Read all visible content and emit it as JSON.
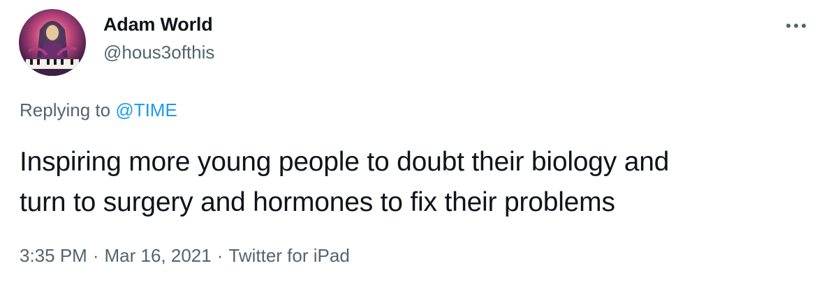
{
  "tweet": {
    "author": {
      "display_name": "Adam World",
      "handle": "@hous3ofthis",
      "avatar_icon": "profile-avatar"
    },
    "more_icon": "more-options-icon",
    "reply": {
      "prefix": "Replying to",
      "mention": "@TIME"
    },
    "text_line1": "Inspiring more young people to doubt their biology and",
    "text_line2": "turn to surgery and hormones to fix their problems",
    "meta": {
      "time": "3:35 PM",
      "date": "Mar 16, 2021",
      "source": "Twitter for iPad",
      "separator": "·"
    }
  },
  "colors": {
    "primary_text": "#0f1419",
    "secondary_text": "#536471",
    "link": "#1d9bf0",
    "background": "#ffffff"
  }
}
